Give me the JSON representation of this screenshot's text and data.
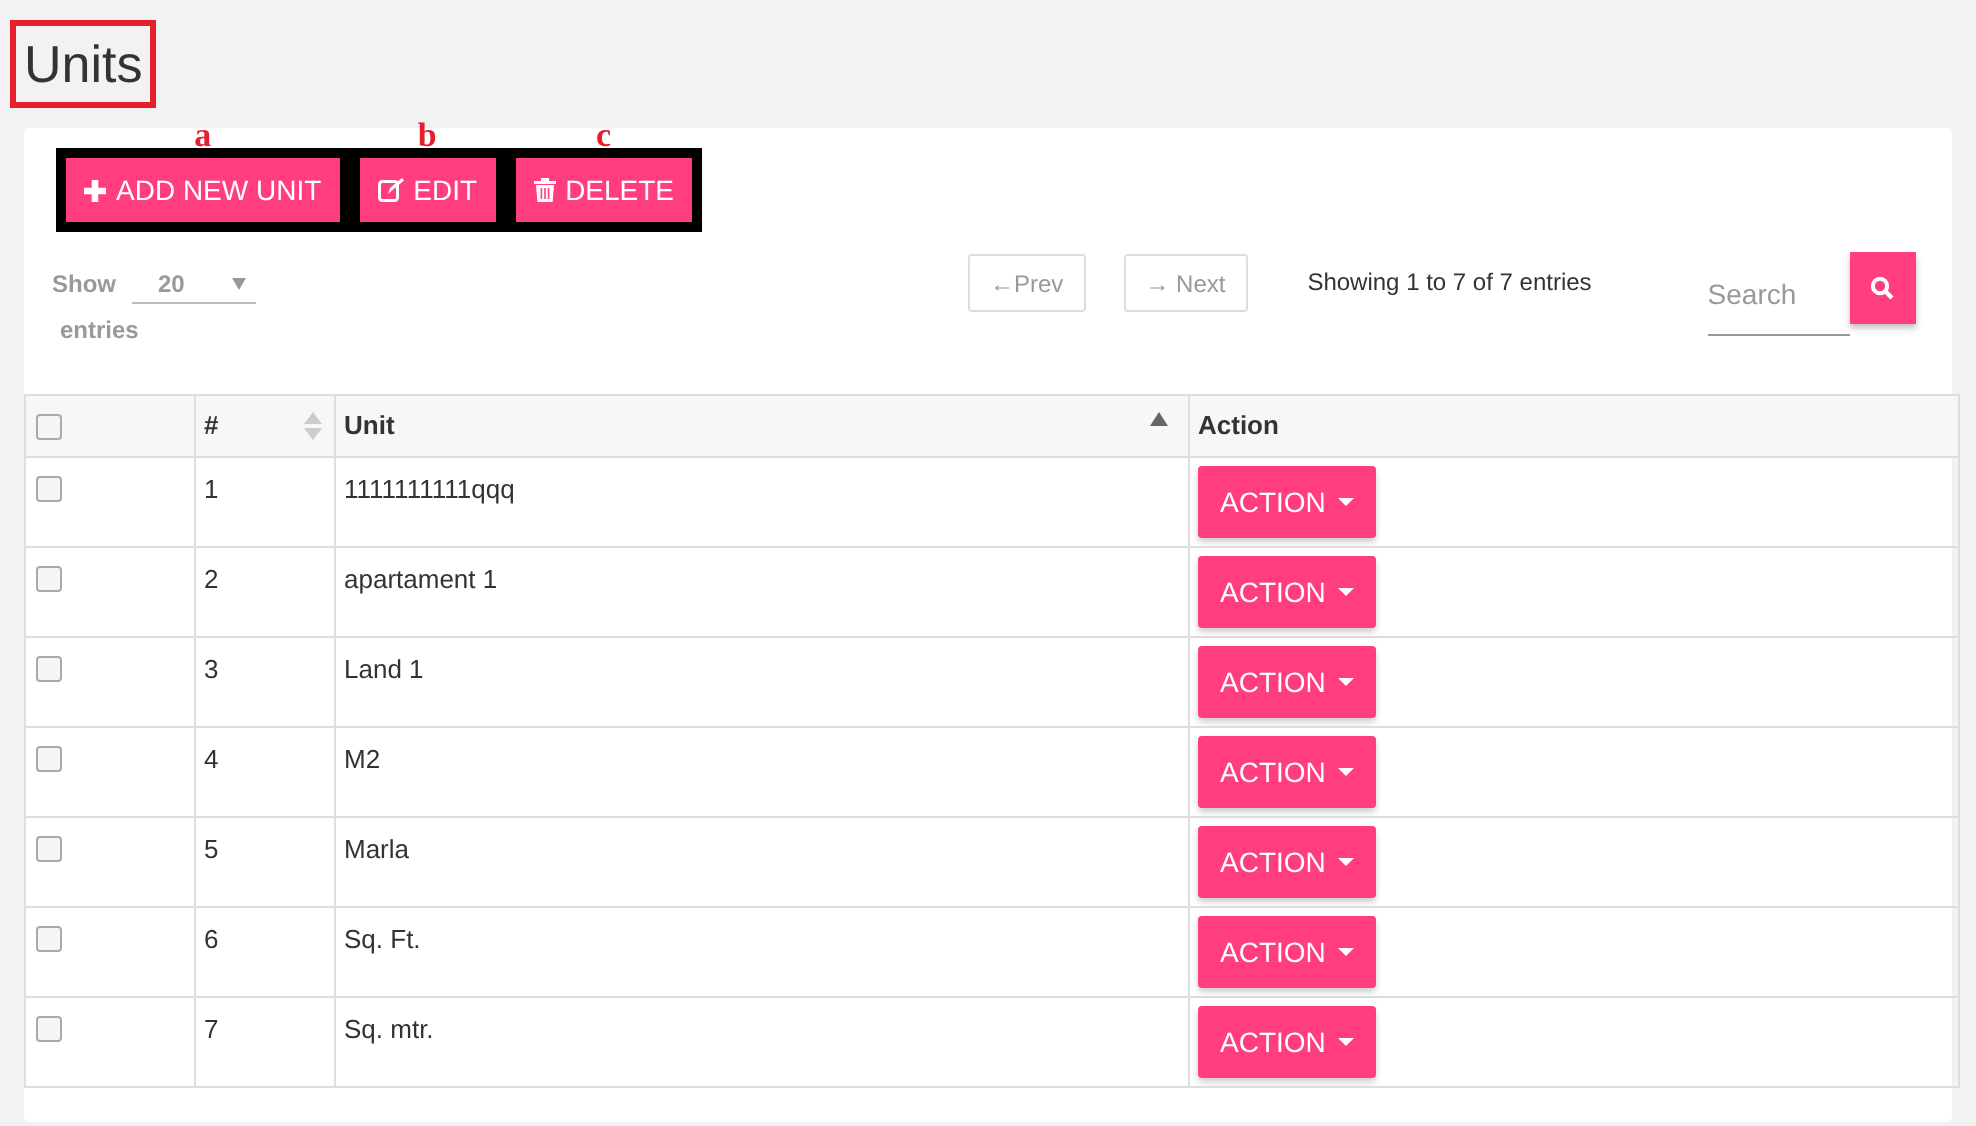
{
  "page_title": "Units",
  "toolbar": [
    {
      "kind": "add",
      "label": "ADD NEW UNIT",
      "marker": "a"
    },
    {
      "kind": "edit",
      "label": "EDIT",
      "marker": "b"
    },
    {
      "kind": "delete",
      "label": "DELETE",
      "marker": "c"
    }
  ],
  "length": {
    "show": "Show",
    "value": "20",
    "entries": "entries"
  },
  "pager": {
    "prev": "←Prev",
    "next": "→ Next",
    "info": "Showing 1 to 7 of 7 entries"
  },
  "search": {
    "placeholder": "Search"
  },
  "table": {
    "select_all": {
      "checked": false
    },
    "columns": [
      "#",
      "Unit",
      "Action"
    ],
    "rows": [
      {
        "checked": false,
        "cells": [
          "1",
          "1111111111qqq"
        ],
        "action": "ACTION"
      },
      {
        "checked": false,
        "cells": [
          "2",
          "apartament 1"
        ],
        "action": "ACTION"
      },
      {
        "checked": false,
        "cells": [
          "3",
          "Land 1"
        ],
        "action": "ACTION"
      },
      {
        "checked": false,
        "cells": [
          "4",
          "M2"
        ],
        "action": "ACTION"
      },
      {
        "checked": false,
        "cells": [
          "5",
          "Marla"
        ],
        "action": "ACTION"
      },
      {
        "checked": false,
        "cells": [
          "6",
          "Sq. Ft."
        ],
        "action": "ACTION"
      },
      {
        "checked": false,
        "cells": [
          "7",
          "Sq. mtr."
        ],
        "action": "ACTION"
      }
    ]
  }
}
